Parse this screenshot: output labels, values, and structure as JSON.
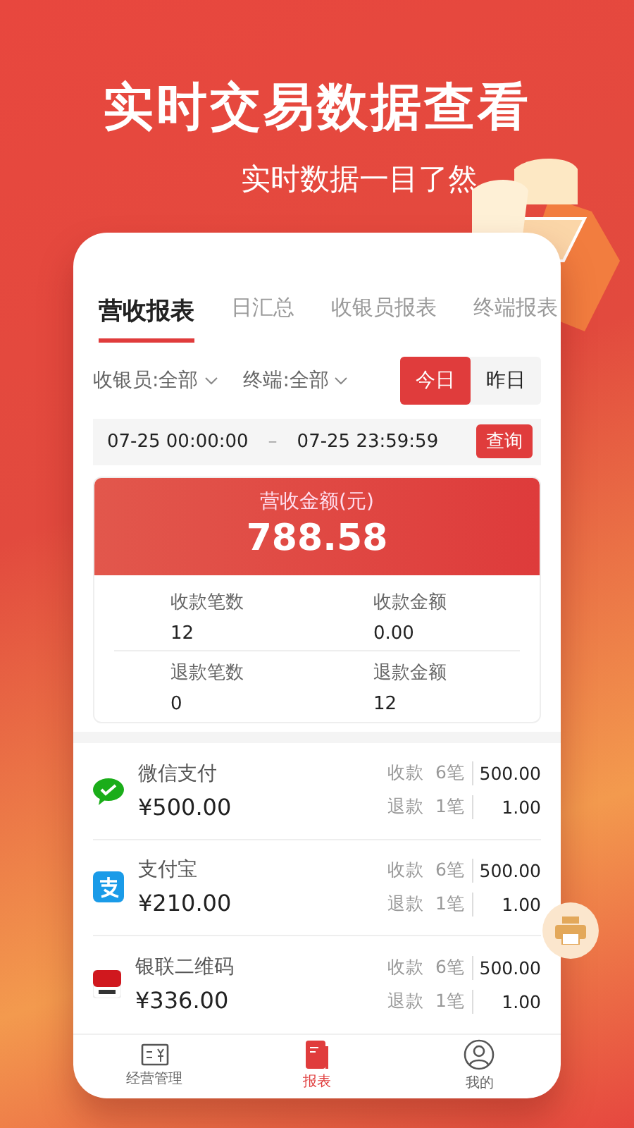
{
  "header": {
    "title": "实时交易数据查看",
    "subtitle": "实时数据一目了然"
  },
  "tabs": [
    {
      "label": "营收报表",
      "selected": true
    },
    {
      "label": "日汇总",
      "selected": false
    },
    {
      "label": "收银员报表",
      "selected": false
    },
    {
      "label": "终端报表",
      "selected": false
    }
  ],
  "filters": [
    {
      "label": "收银员:全部"
    },
    {
      "label": "终端:全部"
    }
  ],
  "day_toggle": [
    {
      "label": "今日",
      "selected": true
    },
    {
      "label": "昨日",
      "selected": false
    }
  ],
  "date_range": {
    "start": "07-25 00:00:00",
    "separator": "–",
    "end": "07-25 23:59:59",
    "button": "查询"
  },
  "summary": {
    "title": "营收金额(元)",
    "amount": "788.58",
    "stats": [
      {
        "label": "收款笔数",
        "value": "12"
      },
      {
        "label": "收款金额",
        "value": "0.00"
      },
      {
        "label": "退款笔数",
        "value": "0"
      },
      {
        "label": "退款金额",
        "value": "12"
      }
    ]
  },
  "payments": [
    {
      "kind": "wechat",
      "name": "微信支付",
      "amount": "¥500.00",
      "rows": [
        {
          "label": "收款",
          "count": "6笔",
          "value": "500.00"
        },
        {
          "label": "退款",
          "count": "1笔",
          "value": "1.00"
        }
      ]
    },
    {
      "kind": "alipay",
      "name": "支付宝",
      "amount": "¥210.00",
      "rows": [
        {
          "label": "收款",
          "count": "6笔",
          "value": "500.00"
        },
        {
          "label": "退款",
          "count": "1笔",
          "value": "1.00"
        }
      ]
    },
    {
      "kind": "unionpay",
      "name": "银联二维码",
      "amount": "¥336.00",
      "rows": [
        {
          "label": "收款",
          "count": "6笔",
          "value": "500.00"
        },
        {
          "label": "退款",
          "count": "1笔",
          "value": "1.00"
        }
      ]
    }
  ],
  "bottom_nav": [
    {
      "kind": "manage",
      "label": "经营管理",
      "selected": false
    },
    {
      "kind": "report",
      "label": "报表",
      "selected": true
    },
    {
      "kind": "profile",
      "label": "我的",
      "selected": false
    }
  ]
}
